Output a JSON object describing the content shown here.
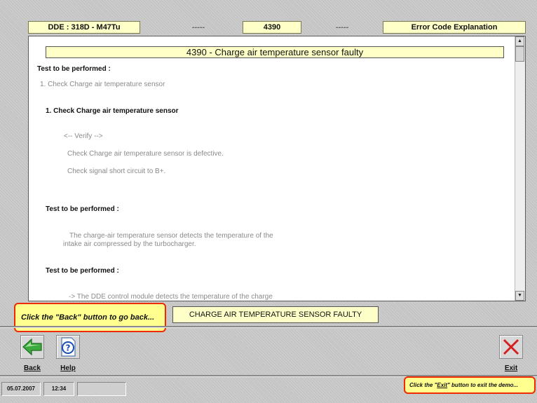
{
  "header": {
    "module": "DDE : 318D - M47Tu",
    "dash_left": "-----",
    "code": "4390",
    "dash_right": "-----",
    "view": "Error Code Explanation"
  },
  "content": {
    "title": "4390 - Charge air temperature sensor faulty",
    "lines": [
      "Test to be performed :",
      "1. Check Charge air temperature sensor",
      "1. Check Charge air temperature sensor",
      "<-- Verify -->",
      "Check Charge air temperature sensor is defective.",
      "Check signal short circuit to B+.",
      "Test to be performed :",
      "The charge-air temperature sensor detects the temperature of the",
      "intake air compressed by the turbocharger.",
      "Test to be performed :",
      "-> The DDE control module detects the temperature of the charge"
    ]
  },
  "status": "CHARGE AIR TEMPERATURE SENSOR FAULTY",
  "hints": {
    "back": "Click the \"Back\" button to go back...",
    "exit_prefix": "Click the \"",
    "exit_word": "Exit",
    "exit_suffix": "\" button to exit the demo..."
  },
  "toolbar": {
    "back_label": "Back",
    "help_label": "Help",
    "exit_label": "Exit",
    "back_icon": "back-arrow-icon",
    "help_icon": "help-question-icon",
    "exit_icon": "exit-x-icon"
  },
  "footer": {
    "date": "05.07.2007",
    "time": "12:34",
    "field": ""
  },
  "colors": {
    "yellow_box": "#ffffc8",
    "hint_fill": "#ffff90",
    "hint_border": "#ee2a00",
    "back_arrow": "#3caa3c",
    "exit_x": "#d42020"
  }
}
